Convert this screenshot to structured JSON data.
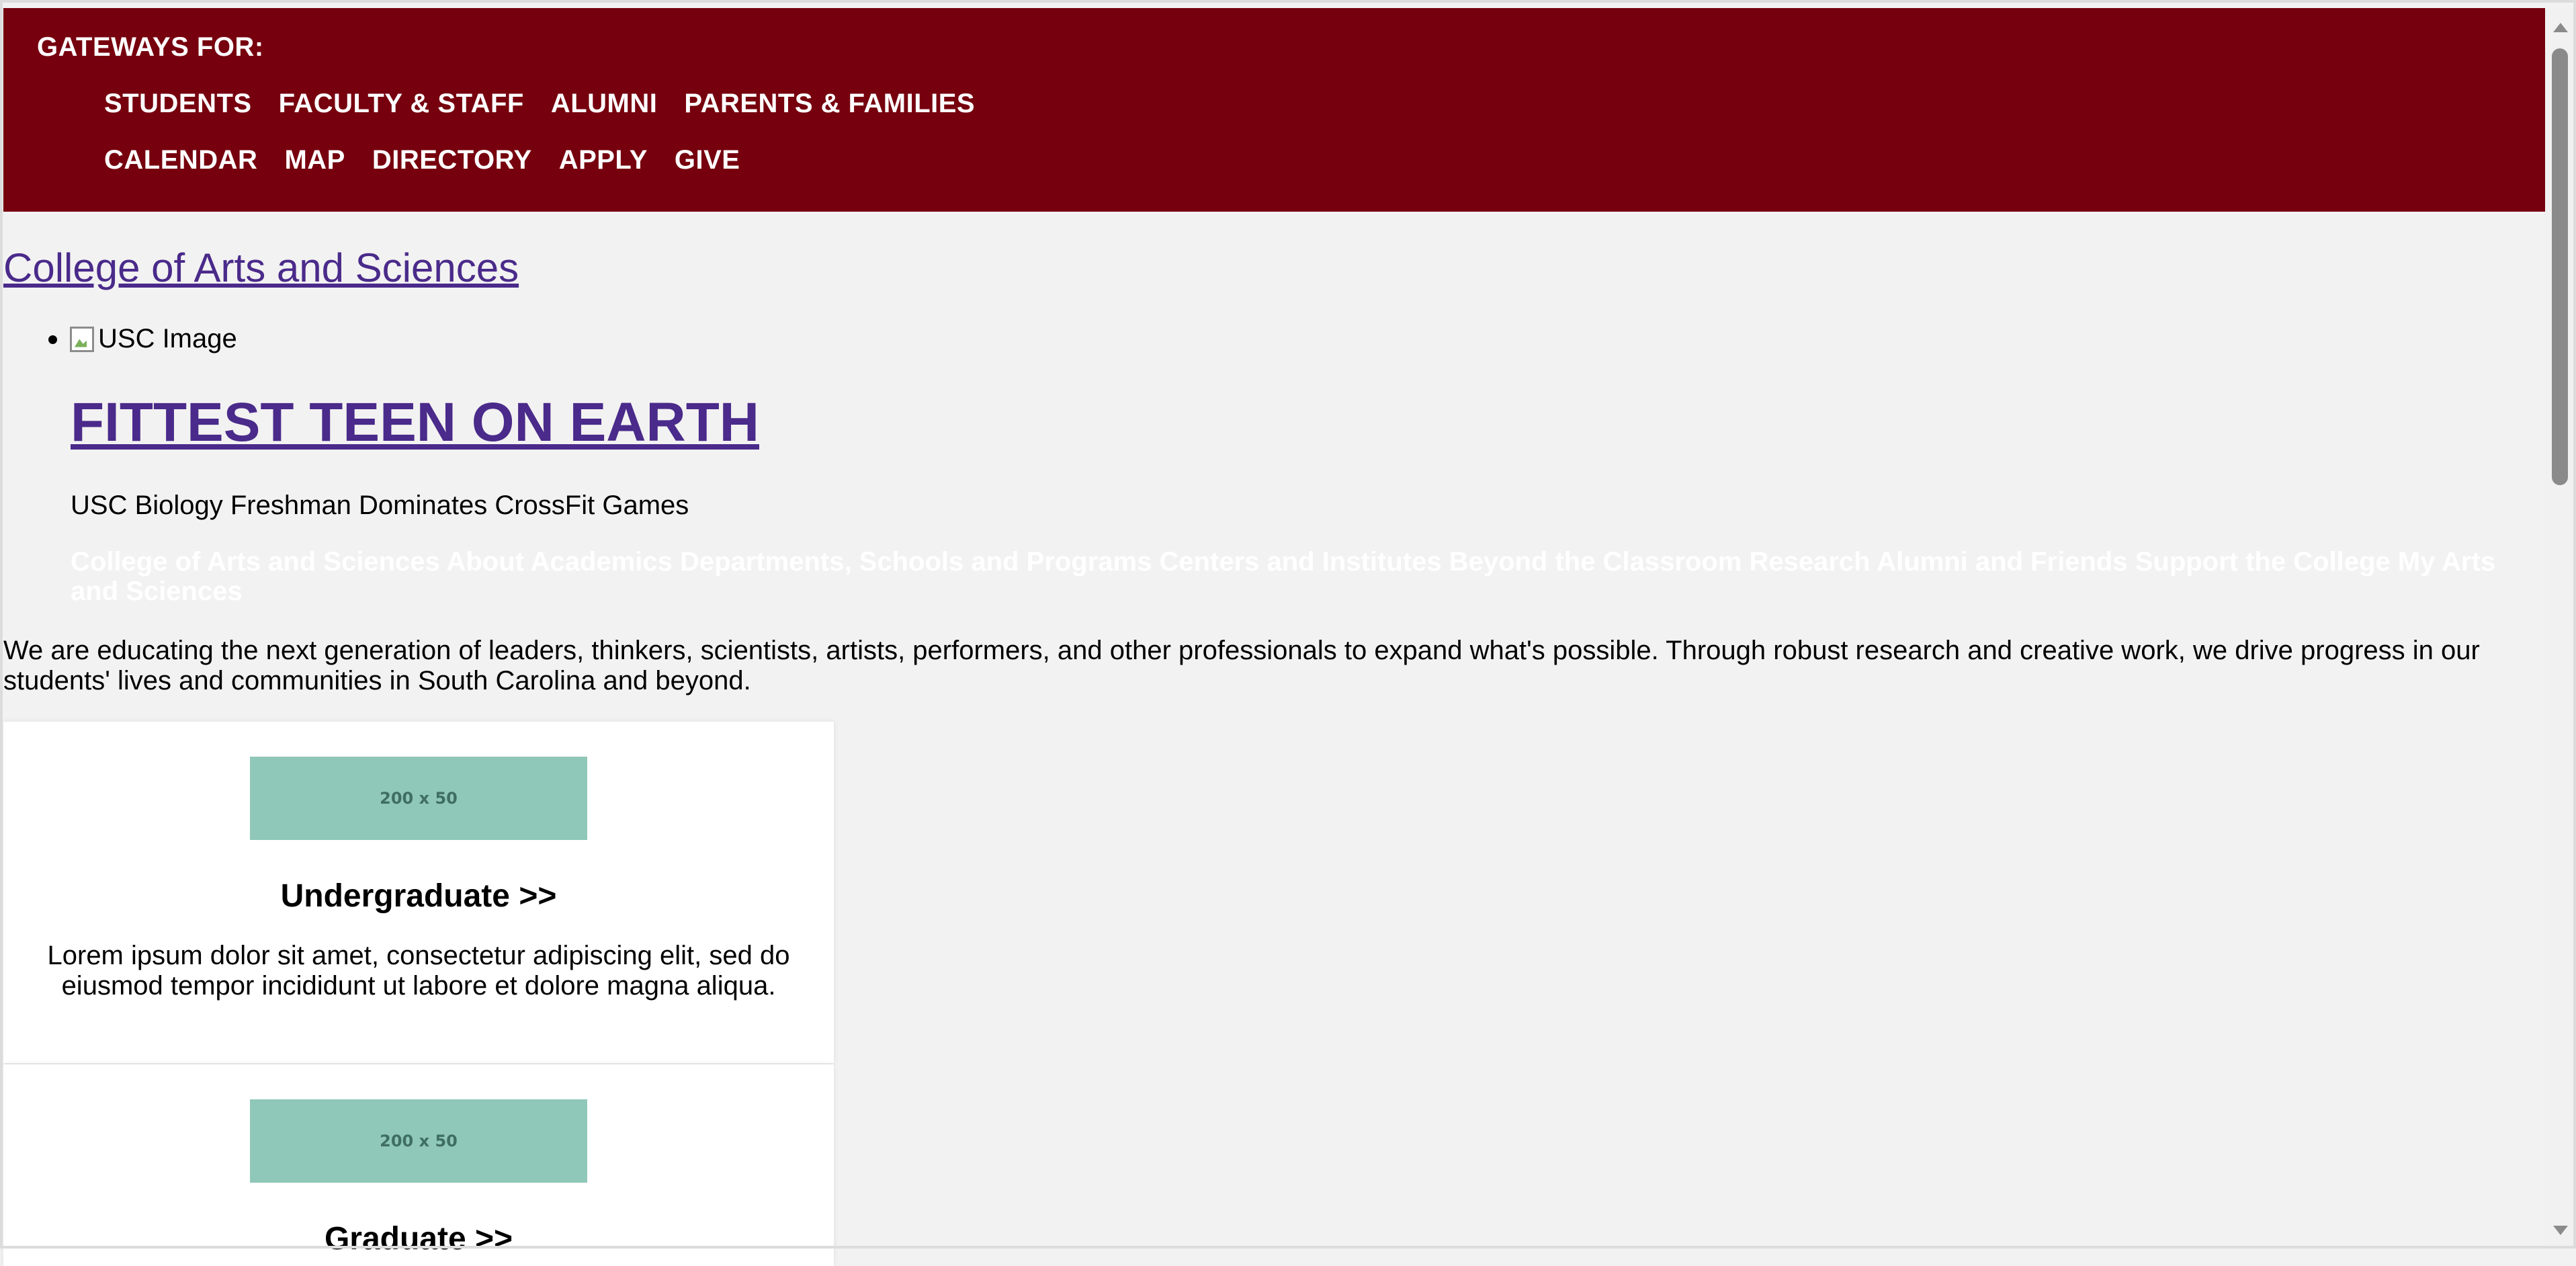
{
  "gateway": {
    "label": "GATEWAYS FOR:",
    "row1": [
      "STUDENTS",
      "FACULTY & STAFF",
      "ALUMNI",
      "PARENTS & FAMILIES"
    ],
    "row2": [
      "CALENDAR",
      "MAP",
      "DIRECTORY",
      "APPLY",
      "GIVE"
    ]
  },
  "site": {
    "title": "College of Arts and Sciences"
  },
  "slide": {
    "image_alt": "USC Image",
    "headline": "FITTEST TEEN ON EARTH",
    "subhead": "USC Biology Freshman Dominates CrossFit Games"
  },
  "nav": {
    "items": [
      "College of Arts and Sciences",
      "About",
      "Academics",
      "Departments, Schools and Programs",
      "Centers and Institutes",
      "Beyond the Classroom",
      "Research",
      "Alumni and Friends",
      "Support the College",
      "My Arts and Sciences"
    ]
  },
  "intro": "We are educating the next generation of leaders, thinkers, scientists, artists, performers, and other professionals to expand what's possible. Through robust research and creative work, we drive progress in our students' lives and communities in South Carolina and beyond.",
  "cards": [
    {
      "placeholder": "200 x 50",
      "title": "Undergraduate >>",
      "text": "Lorem ipsum dolor sit amet, consectetur adipiscing elit, sed do eiusmod tempor incididunt ut labore et dolore magna aliqua."
    },
    {
      "placeholder": "200 x 50",
      "title": "Graduate >>",
      "text": ""
    }
  ],
  "colors": {
    "gateway_bg": "#76000e",
    "link": "#4a2a8a",
    "page_bg": "#f2f2f2",
    "placeholder_bg": "#8fc7b8"
  }
}
